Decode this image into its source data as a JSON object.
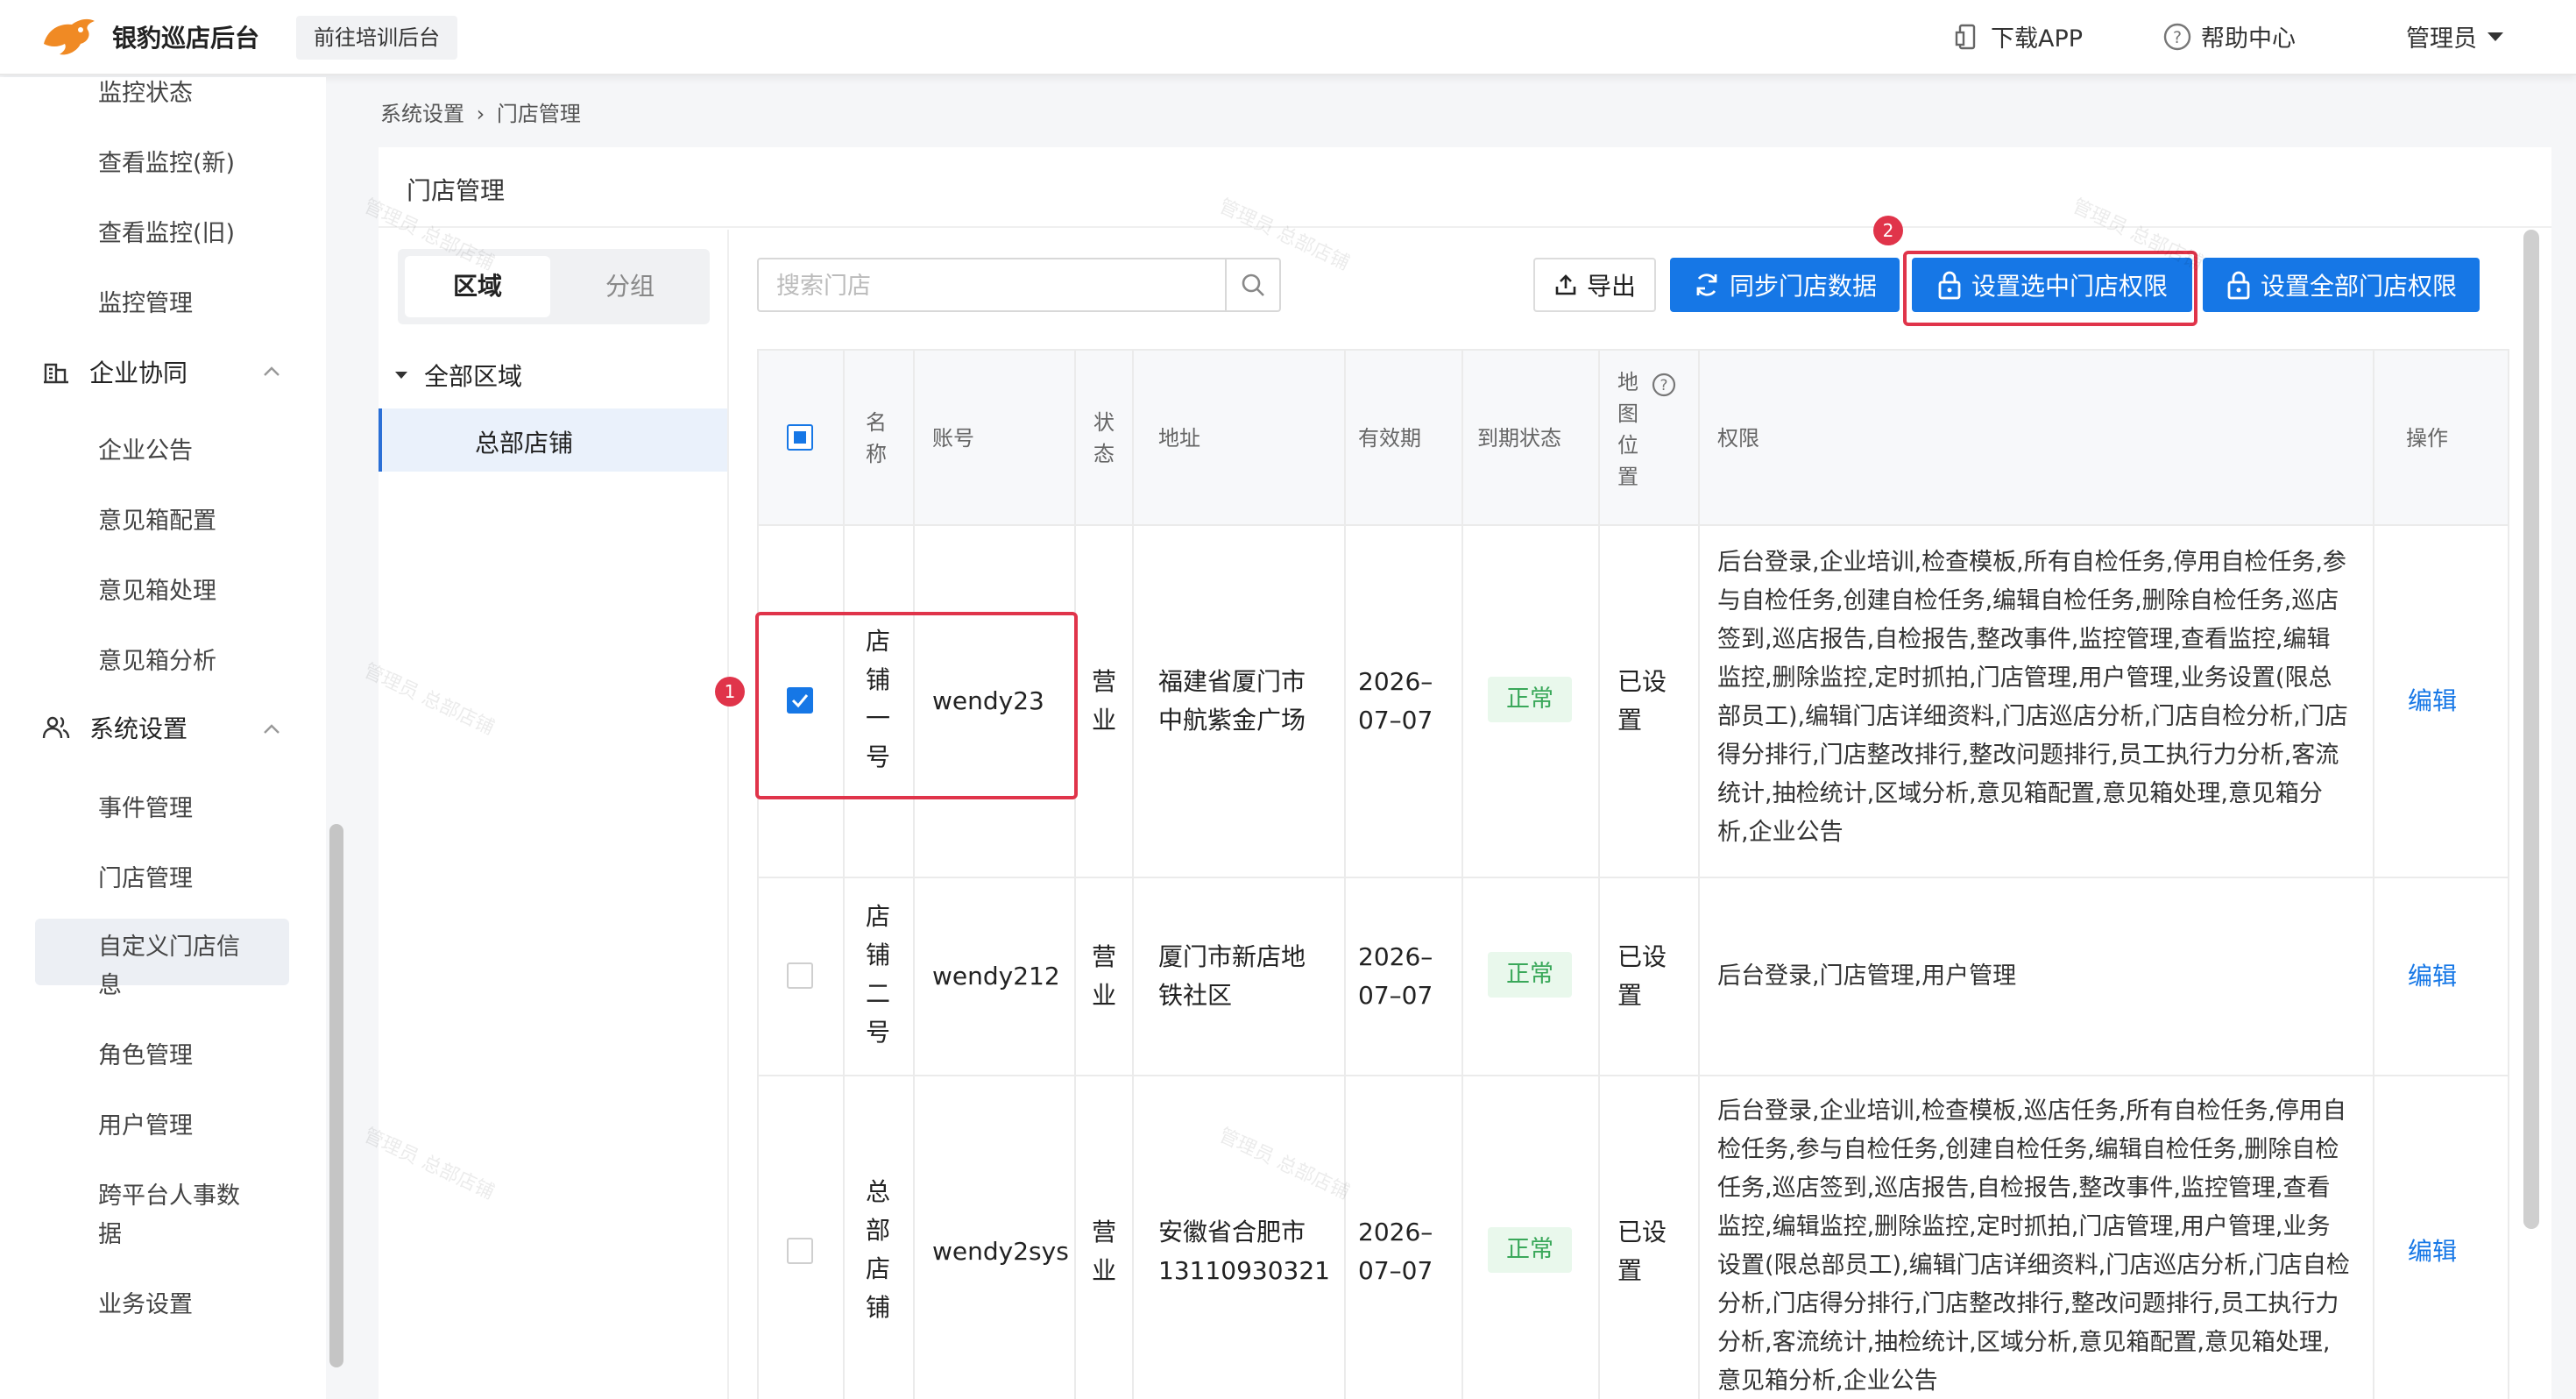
{
  "header": {
    "brand": "银豹巡店后台",
    "train_button": "前往培训后台",
    "download": "下载APP",
    "help": "帮助中心",
    "user": "管理员"
  },
  "sidebar": {
    "items_top": [
      "监控状态",
      "查看监控(新)",
      "查看监控(旧)",
      "监控管理"
    ],
    "group_enterprise": "企业协同",
    "items_enterprise": [
      "企业公告",
      "意见箱配置",
      "意见箱处理",
      "意见箱分析"
    ],
    "group_system": "系统设置",
    "items_system": [
      "事件管理",
      "门店管理",
      "自定义门店信",
      "息",
      "角色管理",
      "用户管理",
      "跨平台人事数",
      "据",
      "业务设置"
    ]
  },
  "breadcrumb": {
    "parent": "系统设置",
    "separator": "›",
    "current": "门店管理"
  },
  "panel": {
    "title": "门店管理",
    "tabs": [
      "区域",
      "分组"
    ],
    "tree_root": "全部区域",
    "tree_node": "总部店铺"
  },
  "toolbar": {
    "search_placeholder": "搜索门店",
    "export": "导出",
    "sync": "同步门店数据",
    "set_selected": "设置选中门店权限",
    "set_all": "设置全部门店权限",
    "badge1": "1",
    "badge2": "2"
  },
  "table": {
    "headers": {
      "name": [
        "名",
        "称"
      ],
      "account": "账号",
      "status": [
        "状",
        "态"
      ],
      "address": "地址",
      "valid": "有效期",
      "expiry_status": "到期状态",
      "map": [
        "地",
        "图",
        "位",
        "置"
      ],
      "perm": "权限",
      "ops": "操作"
    },
    "rows": [
      {
        "name": [
          "店",
          "铺",
          "一",
          "号"
        ],
        "account": "wendy23",
        "status": [
          "营",
          "业"
        ],
        "address": [
          "福建省厦门市",
          "中航紫金广场"
        ],
        "valid": [
          "2026–",
          "07–07"
        ],
        "expiry": "正常",
        "map": [
          "已设",
          "置"
        ],
        "perm": [
          "后台登录,企业培训,检查模板,所有自检任务,停用自检任务,参",
          "与自检任务,创建自检任务,编辑自检任务,删除自检任务,巡店",
          "签到,巡店报告,自检报告,整改事件,监控管理,查看监控,编辑",
          "监控,删除监控,定时抓拍,门店管理,用户管理,业务设置(限总",
          "部员工),编辑门店详细资料,门店巡店分析,门店自检分析,门店",
          "得分排行,门店整改排行,整改问题排行,员工执行力分析,客流",
          "统计,抽检统计,区域分析,意见箱配置,意见箱处理,意见箱分",
          "析,企业公告"
        ],
        "op": "编辑",
        "checked": true
      },
      {
        "name": [
          "店",
          "铺",
          "二",
          "号"
        ],
        "account": "wendy212",
        "status": [
          "营",
          "业"
        ],
        "address": [
          "厦门市新店地",
          "铁社区"
        ],
        "valid": [
          "2026–",
          "07–07"
        ],
        "expiry": "正常",
        "map": [
          "已设",
          "置"
        ],
        "perm": [
          "后台登录,门店管理,用户管理"
        ],
        "op": "编辑",
        "checked": false
      },
      {
        "name": [
          "总",
          "部",
          "店",
          "铺"
        ],
        "account": "wendy2sys",
        "status": [
          "营",
          "业"
        ],
        "address": [
          "安徽省合肥市",
          "13110930321"
        ],
        "valid": [
          "2026–",
          "07–07"
        ],
        "expiry": "正常",
        "map": [
          "已设",
          "置"
        ],
        "perm": [
          "后台登录,企业培训,检查模板,巡店任务,所有自检任务,停用自",
          "检任务,参与自检任务,创建自检任务,编辑自检任务,删除自检",
          "任务,巡店签到,巡店报告,自检报告,整改事件,监控管理,查看",
          "监控,编辑监控,删除监控,定时抓拍,门店管理,用户管理,业务",
          "设置(限总部员工),编辑门店详细资料,门店巡店分析,门店自检",
          "分析,门店得分排行,门店整改排行,整改问题排行,员工执行力",
          "分析,客流统计,抽检统计,区域分析,意见箱配置,意见箱处理,",
          "意见箱分析,企业公告"
        ],
        "op": "编辑",
        "checked": false
      }
    ]
  },
  "watermark": "管理员 总部店铺",
  "colors": {
    "primary": "#1677e6",
    "highlight": "#e0344a",
    "ok_green": "#3aa85a",
    "logo": "#f08a24"
  }
}
